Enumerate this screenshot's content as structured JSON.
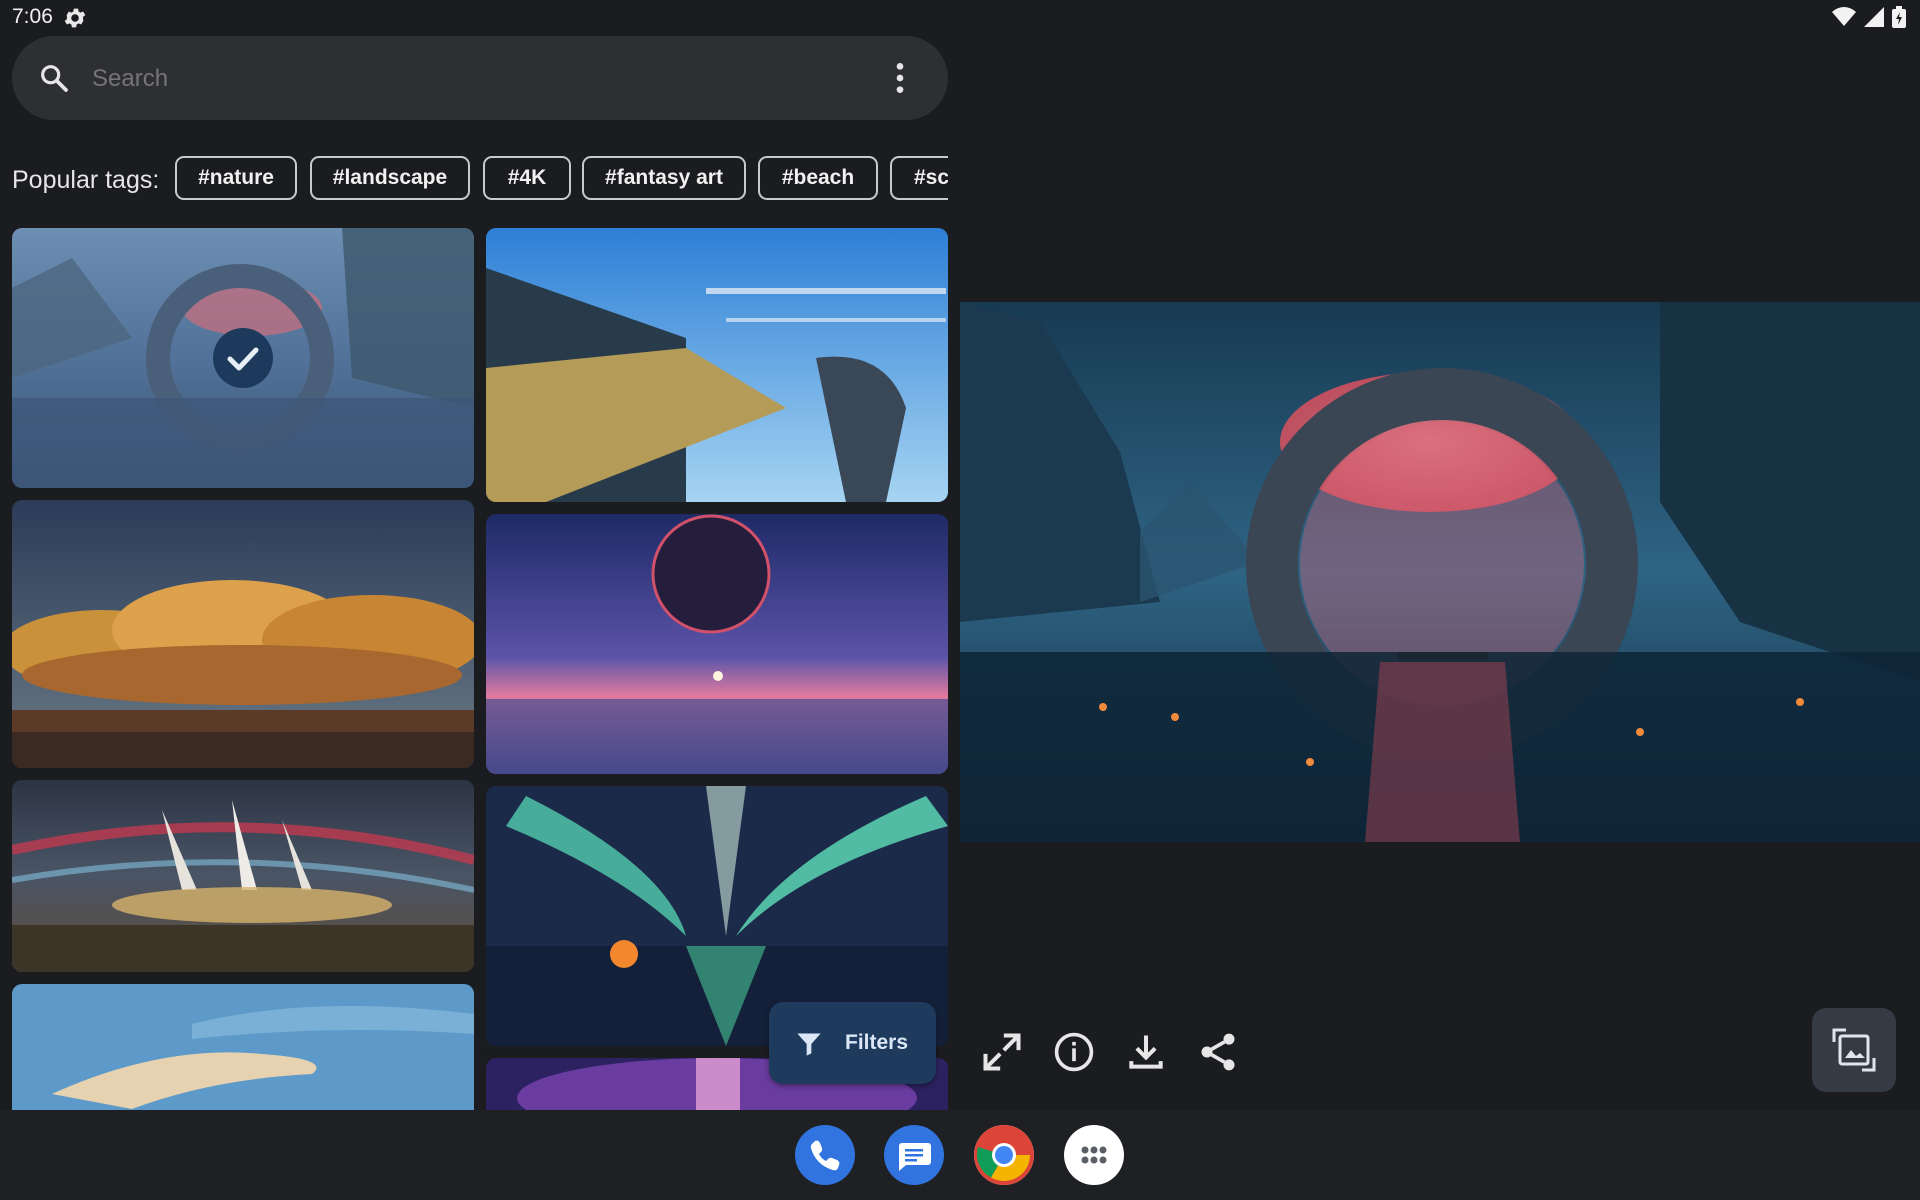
{
  "status_bar": {
    "time": "7:06"
  },
  "search": {
    "placeholder": "Search"
  },
  "tags": {
    "label": "Popular tags:",
    "items": [
      "#nature",
      "#landscape",
      "#4K",
      "#fantasy art",
      "#beach",
      "#sc"
    ]
  },
  "gallery": {
    "items": [
      {
        "name": "portal-ring-lake",
        "selected": true
      },
      {
        "name": "sky-station-train"
      },
      {
        "name": "golden-clouds-village"
      },
      {
        "name": "purple-planet-sunset"
      },
      {
        "name": "rocket-launch-field"
      },
      {
        "name": "aurora-lake-camp"
      },
      {
        "name": "blue-sky-clouds"
      },
      {
        "name": "galaxy-nebula"
      }
    ]
  },
  "filters": {
    "label": "Filters"
  },
  "preview": {
    "name": "portal-ring-lake"
  },
  "actions": {
    "icons": [
      "fullscreen-icon",
      "info-icon",
      "download-icon",
      "share-icon"
    ],
    "fit_icon": "crop-image-icon"
  },
  "dock": {
    "apps": [
      "phone-app-icon",
      "messages-app-icon",
      "chrome-app-icon",
      "app-drawer-icon"
    ]
  },
  "colors": {
    "background": "#1b1c1f",
    "search_bar": "#2d2f33",
    "accent_button": "#1e3a5c",
    "dock_blue": "#3174e0"
  }
}
